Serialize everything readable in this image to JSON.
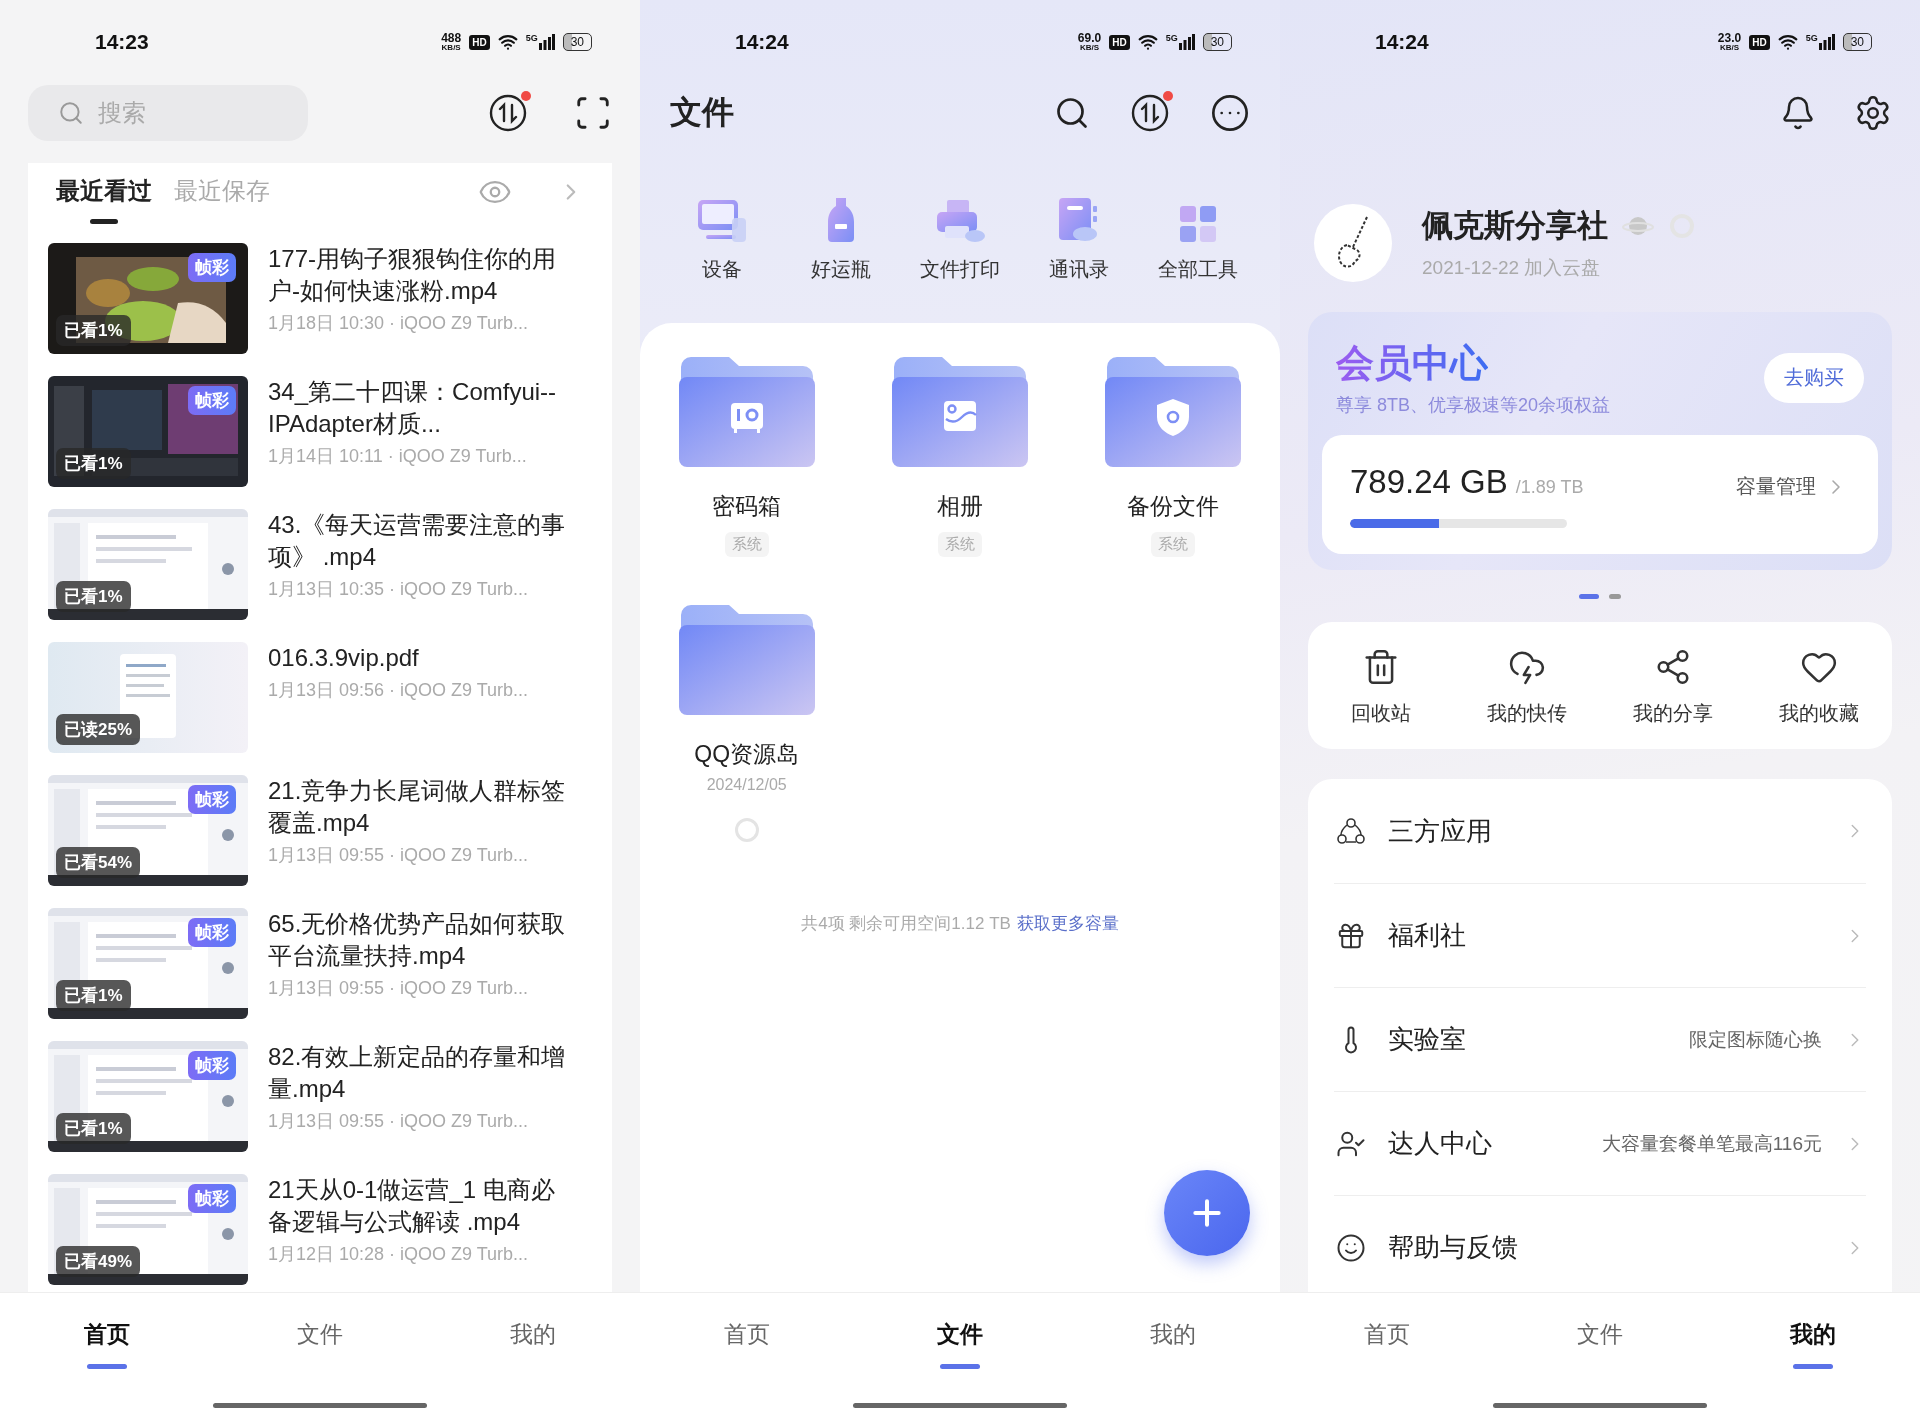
{
  "home": {
    "status_bar": {
      "time": "14:23",
      "speed": "488",
      "speed_unit": "KB/S",
      "hd": "HD",
      "network": "5G",
      "battery": "30"
    },
    "search": {
      "placeholder": "搜索"
    },
    "transfer_badge": true,
    "tabs": [
      {
        "label": "最近看过",
        "selected": true
      },
      {
        "label": "最近保存",
        "selected": false
      }
    ],
    "items": [
      {
        "title": "177-用钩子狠狠钩住你的用户-如何快速涨粉.mp4",
        "meta": "1月18日 10:30 · iQOO Z9 Turb...",
        "progress": "已看1%",
        "tag": "帧彩"
      },
      {
        "title": "34_第二十四课：Comfyui--IPAdapter材质...",
        "meta": "1月14日 10:11 · iQOO Z9 Turb...",
        "progress": "已看1%",
        "tag": "帧彩"
      },
      {
        "title": "43.《每天运营需要注意的事项》 .mp4",
        "meta": "1月13日 10:35 · iQOO Z9 Turb...",
        "progress": "已看1%"
      },
      {
        "title": "016.3.9vip.pdf",
        "meta": "1月13日 09:56 · iQOO Z9 Turb...",
        "progress": "已读25%"
      },
      {
        "title": "21.竞争力长尾词做人群标签覆盖.mp4",
        "meta": "1月13日 09:55 · iQOO Z9 Turb...",
        "progress": "已看54%",
        "tag": "帧彩"
      },
      {
        "title": "65.无价格优势产品如何获取平台流量扶持.mp4",
        "meta": "1月13日 09:55 · iQOO Z9 Turb...",
        "progress": "已看1%",
        "tag": "帧彩"
      },
      {
        "title": "82.有效上新定品的存量和增量.mp4",
        "meta": "1月13日 09:55 · iQOO Z9 Turb...",
        "progress": "已看1%",
        "tag": "帧彩"
      },
      {
        "title": "21天从0-1做运营_1 电商必备逻辑与公式解读 .mp4",
        "meta": "1月12日 10:28 · iQOO Z9 Turb...",
        "progress": "已看49%",
        "tag": "帧彩"
      }
    ],
    "bottom_nav": [
      {
        "label": "首页",
        "selected": true
      },
      {
        "label": "文件",
        "selected": false
      },
      {
        "label": "我的",
        "selected": false
      }
    ]
  },
  "files": {
    "status_bar": {
      "time": "14:24",
      "speed": "69.0",
      "speed_unit": "KB/S",
      "hd": "HD",
      "network": "5G",
      "battery": "30"
    },
    "title": "文件",
    "transfer_badge": true,
    "tools": [
      {
        "label": "设备",
        "kind": "device"
      },
      {
        "label": "好运瓶",
        "kind": "bottle"
      },
      {
        "label": "文件打印",
        "kind": "printer"
      },
      {
        "label": "通讯录",
        "kind": "contacts"
      },
      {
        "label": "全部工具",
        "kind": "grid"
      }
    ],
    "folders": [
      {
        "name": "密码箱",
        "tag": "系统",
        "kind": "safe"
      },
      {
        "name": "相册",
        "tag": "系统"
      },
      {
        "name": "备份文件",
        "tag": "系统",
        "kind": "backup"
      },
      {
        "name": "QQ资源岛",
        "date": "2024/12/05",
        "kind": "plain",
        "selected": false
      }
    ],
    "footer": {
      "text": "共4项 剩余可用空间1.12 TB",
      "link": "获取更多容量"
    },
    "bottom_nav": [
      {
        "label": "首页",
        "selected": false
      },
      {
        "label": "文件",
        "selected": true
      },
      {
        "label": "我的",
        "selected": false
      }
    ]
  },
  "profile": {
    "status_bar": {
      "time": "14:24",
      "speed": "23.0",
      "speed_unit": "KB/S",
      "hd": "HD",
      "network": "5G",
      "battery": "30"
    },
    "name": "佩克斯分享社",
    "joined": "2021-12-22 加入云盘",
    "member": {
      "title": "会员中心",
      "subtitle": "尊享 8TB、优享极速等20余项权益",
      "button": "去购买",
      "used": "789.24 GB",
      "total": "/1.89 TB",
      "manage": "容量管理",
      "level": 0.41
    },
    "pages": [
      {
        "selected": true
      },
      {
        "selected": false
      }
    ],
    "quick": [
      {
        "label": "回收站",
        "kind": "trash"
      },
      {
        "label": "我的快传",
        "kind": "transfer"
      },
      {
        "label": "我的分享",
        "kind": "share"
      },
      {
        "label": "我的收藏",
        "kind": "favorite"
      }
    ],
    "menu": [
      {
        "label": "三方应用",
        "kind": "apps"
      },
      {
        "label": "福利社",
        "kind": "gift"
      },
      {
        "label": "实验室",
        "hint": "限定图标随心换",
        "kind": "lab"
      },
      {
        "label": "达人中心",
        "hint": "大容量套餐单笔最高116元",
        "kind": "expert"
      },
      {
        "label": "帮助与反馈",
        "kind": "help"
      }
    ],
    "bottom_nav": [
      {
        "label": "首页",
        "selected": false
      },
      {
        "label": "文件",
        "selected": false
      },
      {
        "label": "我的",
        "selected": true
      }
    ]
  }
}
